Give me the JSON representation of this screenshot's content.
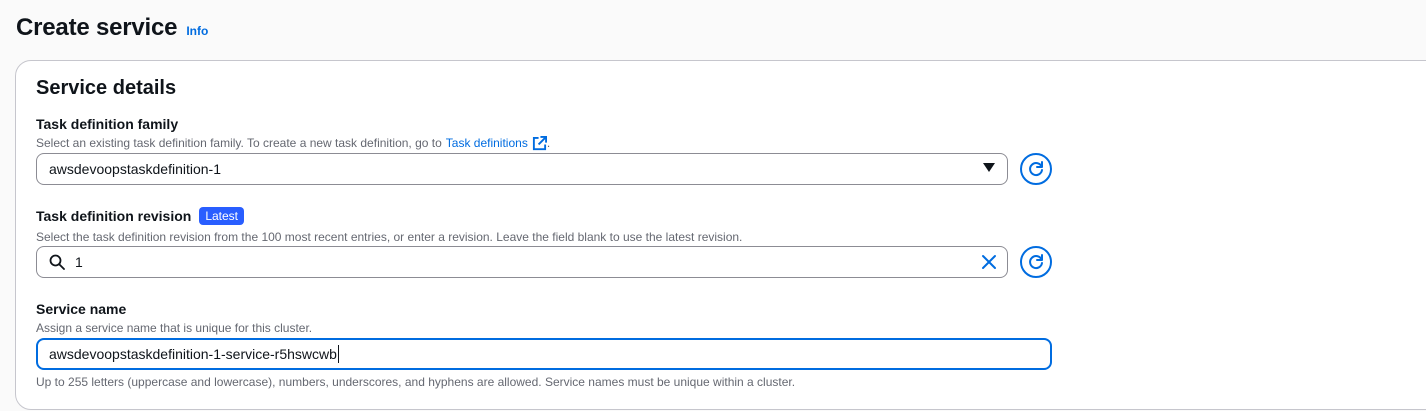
{
  "header": {
    "title": "Create service",
    "info_label": "Info"
  },
  "section": {
    "title": "Service details"
  },
  "task_family": {
    "label": "Task definition family",
    "description": "Select an existing task definition family. To create a new task definition, go to",
    "link_label": "Task definitions",
    "trailing_period": ".",
    "selected_value": "awsdevoopstaskdefinition-1"
  },
  "task_revision": {
    "label": "Task definition revision",
    "badge": "Latest",
    "description": "Select the task definition revision from the 100 most recent entries, or enter a revision. Leave the field blank to use the latest revision.",
    "value": "1"
  },
  "service_name": {
    "label": "Service name",
    "description": "Assign a service name that is unique for this cluster.",
    "value": "awsdevoopstaskdefinition-1-service-r5hswcwb",
    "constraint": "Up to 255 letters (uppercase and lowercase), numbers, underscores, and hyphens are allowed. Service names must be unique within a cluster."
  },
  "icons": {
    "external_link": "external-link-icon",
    "dropdown": "caret-down-icon",
    "refresh": "refresh-icon",
    "search": "search-icon",
    "clear": "close-icon"
  },
  "colors": {
    "accent": "#006ce0",
    "badge": "#295eff",
    "text": "#0f141a",
    "secondary_text": "#656871",
    "border": "#8c8c94"
  }
}
